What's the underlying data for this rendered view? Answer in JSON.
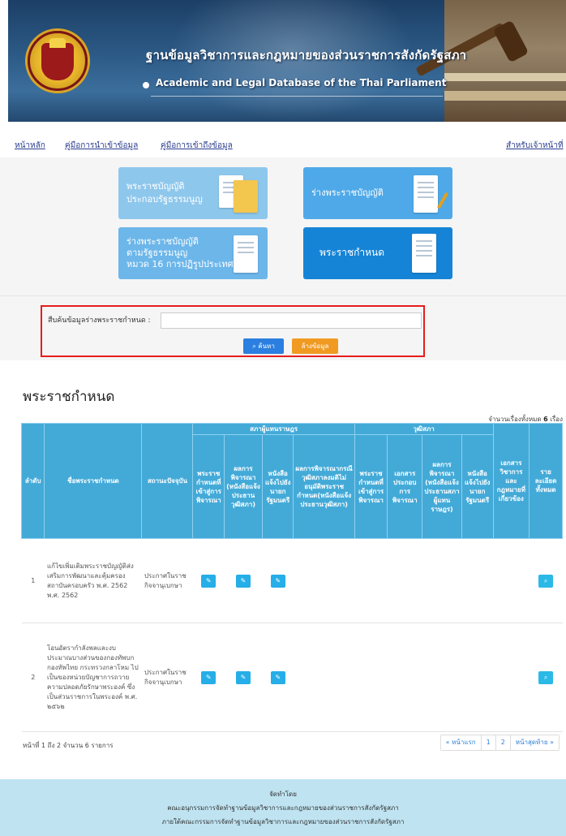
{
  "header": {
    "title_th": "ฐานข้อมูลวิชาการและกฎหมายของส่วนราชการสังกัดรัฐสภา",
    "title_en": "Academic and Legal Database of the Thai Parliament"
  },
  "nav": {
    "home": "หน้าหลัก",
    "import_guide": "คู่มือการนำเข้าข้อมูล",
    "access_guide": "คู่มือการเข้าถึงข้อมูล",
    "staff": "สำหรับเจ้าหน้าที่"
  },
  "cards": [
    {
      "line1": "พระราชบัญญัติ",
      "line2": "ประกอบรัฐธรรมนูญ",
      "line3": "",
      "color": "#8ec7ec"
    },
    {
      "line1": "ร่างพระราชบัญญัติ",
      "line2": "",
      "line3": "",
      "color": "#4fa9e8"
    },
    {
      "line1": "ร่างพระราชบัญญัติ",
      "line2": "ตามรัฐธรรมนูญ",
      "line3": "หมวด 16 การปฏิรูปประเทศ",
      "color": "#6cb6ea"
    },
    {
      "line1": "พระราชกำหนด",
      "line2": "",
      "line3": "",
      "color": "#1684d6"
    }
  ],
  "search": {
    "label": "สืบค้นข้อมูลร่างพระราชกำหนด :",
    "value": "",
    "placeholder": "",
    "search_button": "ค้นหา",
    "clear_button": "ล้างข้อมูล"
  },
  "section": {
    "title": "พระราชกำหนด",
    "total_prefix": "จำนวนเรื่องทั้งหมด",
    "total_count": "6",
    "total_suffix": "เรื่อง"
  },
  "table": {
    "headers": {
      "no": "ลำดับ",
      "name": "ชื่อพระราชกำหนด",
      "status": "สถานะปัจจุบัน",
      "house": "สภาผู้แทนราษฎร",
      "senate": "วุฒิสภา",
      "h_date": "พระราชกำหนดที่เข้าสู่การพิจารณา",
      "h_result": "ผลการพิจารณา (หนังสือแจ้งประธานวุฒิสภา)",
      "h_letter": "หนังสือแจ้งไปยังนายกรัฐมนตรี",
      "h_result2": "ผลการพิจารณากรณีวุฒิสภาลงมติไม่อนุมัติพระราชกำหนด(หนังสือแจ้งประธานวุฒิสภา)",
      "s_date": "พระราชกำหนดที่เข้าสู่การพิจารณา",
      "s_doc": "เอกสารประกอบการพิจารณา",
      "s_result": "ผลการพิจารณา (หนังสือแจ้งประธานสภาผู้แทนราษฎร)",
      "s_letter": "หนังสือแจ้งไปยังนายกรัฐมนตรี",
      "academic": "เอกสารวิชาการและกฎหมายที่เกี่ยวข้อง",
      "detail": "รายละเอียดทั้งหมด"
    },
    "rows": [
      {
        "no": "1",
        "name": "แก้ไขเพิ่มเติมพระราชบัญญัติส่งเสริมการพัฒนาและคุ้มครองสถาบันครอบครัว พ.ศ. 2562 พ.ศ. 2562",
        "status": "ประกาศในราชกิจจานุเบกษา"
      },
      {
        "no": "2",
        "name": "โอนอัตรากำลังพลและงบประมาณบางส่วนของกองทัพบก กองทัพไทย กระทรวงกลาโหม ไปเป็นของหน่วยบัญชาการถวายความปลอดภัยรักษาพระองค์ ซึ่งเป็นส่วนราชการในพระองค์ พ.ศ. ๒๕๖๒",
        "status": "ประกาศในราชกิจจานุเบกษา"
      }
    ]
  },
  "pager": {
    "info": "หน้าที่ 1 ถึง 2 จำนวน 6 รายการ",
    "first": "« หน้าแรก",
    "page1": "1",
    "page2": "2",
    "last": "หน้าสุดท้าย »"
  },
  "footer": {
    "line1": "จัดทำโดย",
    "line2": "คณะอนุกรรมการจัดทำฐานข้อมูลวิชาการและกฎหมายของส่วนราชการสังกัดรัฐสภา",
    "line3": "ภายใต้คณะกรรมการจัดทำฐานข้อมูลวิชาการและกฎหมายของส่วนราชการสังกัดรัฐสภา"
  },
  "colors": {
    "table_header": "#43aad8",
    "search_button": "#2b7fe0",
    "clear_button": "#f09a22",
    "highlight_frame": "#e81c1c",
    "footer": "#bfe3f1"
  },
  "icons": {
    "row_action": "edit-document-icon",
    "detail": "search-icon"
  }
}
